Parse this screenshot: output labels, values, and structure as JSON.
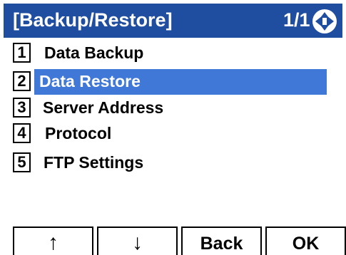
{
  "header": {
    "title": "[Backup/Restore]",
    "page_indicator": "1/1",
    "nav_icon": "four-way-navigation-icon"
  },
  "menu": {
    "selected_index": 1,
    "items": [
      {
        "number": "1",
        "label": "Data Backup"
      },
      {
        "number": "2",
        "label": "Data Restore"
      },
      {
        "number": "3",
        "label": "Server Address"
      },
      {
        "number": "4",
        "label": "Protocol"
      },
      {
        "number": "5",
        "label": "FTP Settings"
      }
    ]
  },
  "softkeys": {
    "up": "↑",
    "down": "↓",
    "back": "Back",
    "ok": "OK"
  },
  "colors": {
    "header_bg": "#1f4da0",
    "selection_bg": "#3f78d6"
  }
}
